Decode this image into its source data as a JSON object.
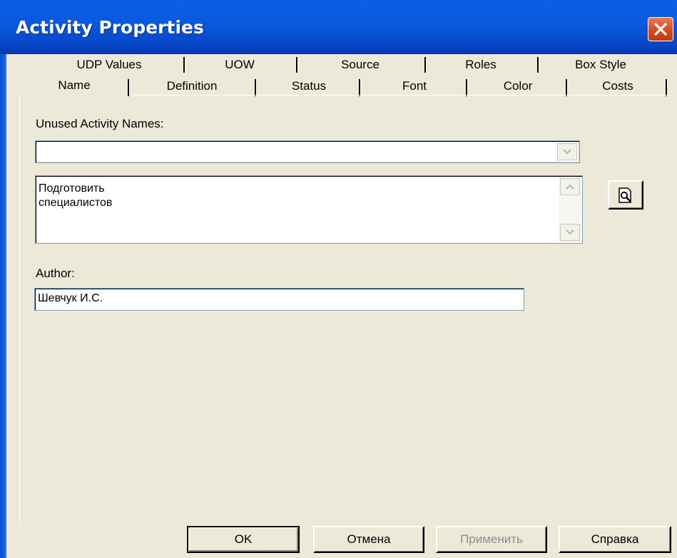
{
  "window": {
    "title": "Activity Properties",
    "close_icon": "close-icon",
    "accent": "#0a5ee8"
  },
  "tabs": {
    "row_back": [
      "UDP Values",
      "UOW",
      "Source",
      "Roles",
      "Box Style"
    ],
    "row_front": [
      "Name",
      "Definition",
      "Status",
      "Font",
      "Color",
      "Costs"
    ],
    "active": "Name"
  },
  "form": {
    "unused_label": "Unused Activity Names:",
    "unused_value": "",
    "name_text": "Подготовить\nспециалистов",
    "author_label": "Author:",
    "author_value": "Шевчук И.С.",
    "browse_icon": "preview-magnifier-icon"
  },
  "buttons": {
    "ok": "OK",
    "cancel": "Отмена",
    "apply": "Применить",
    "help": "Справка"
  }
}
